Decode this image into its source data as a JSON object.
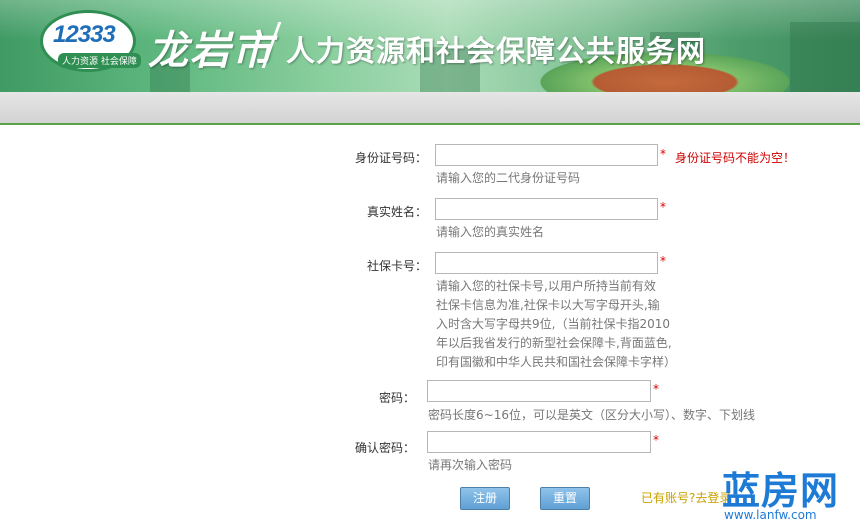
{
  "header": {
    "logo_number": "12333",
    "logo_subtitle": "人力资源  社会保障",
    "city": "龙岩市",
    "site_title": "人力资源和社会保障公共服务网"
  },
  "form": {
    "id_number": {
      "label": "身份证号码：",
      "value": "",
      "required_mark": "*",
      "hint": "请输入您的二代身份证号码",
      "error": "身份证号码不能为空！"
    },
    "real_name": {
      "label": "真实姓名：",
      "value": "",
      "required_mark": "*",
      "hint": "请输入您的真实姓名"
    },
    "social_card": {
      "label": "社保卡号：",
      "value": "",
      "required_mark": "*",
      "hint_lines": [
        "请输入您的社保卡号,以用户所持当前有效",
        "社保卡信息为准,社保卡以大写字母开头,输",
        "入时含大写字母共9位,（当前社保卡指2010",
        "年以后我省发行的新型社会保障卡,背面蓝色,",
        "印有国徽和中华人民共和国社会保障卡字样）"
      ]
    },
    "password": {
      "label": "密码：",
      "value": "",
      "required_mark": "*",
      "hint": "密码长度6~16位，可以是英文（区分大小写）、数字、下划线"
    },
    "confirm_password": {
      "label": "确认密码：",
      "value": "",
      "required_mark": "*",
      "hint": "请再次输入密码"
    },
    "register_label": "注册",
    "reset_label": "重置",
    "login_link": "已有账号?去登录"
  },
  "watermark": {
    "name": "蓝房网",
    "url": "www.lanfw.com"
  },
  "colors": {
    "accent_green": "#5aa14a",
    "error_red": "#d00000",
    "button_blue": "#5f9fd4",
    "link_gold": "#c9a100",
    "watermark_blue": "#1d7bd6"
  }
}
